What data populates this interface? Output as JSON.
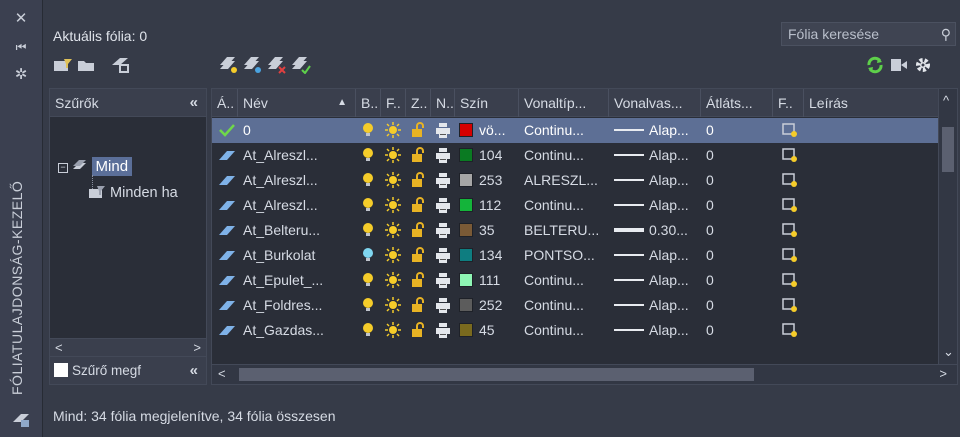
{
  "palette_title": "FÓLIATULAJDONSÁG-KEZELŐ",
  "current_layer_label": "Aktuális fólia: 0",
  "search": {
    "placeholder": "Fólia keresése"
  },
  "filters": {
    "header": "Szűrők",
    "root": "Mind",
    "child": "Minden ha",
    "invert_label": "Szűrő megf"
  },
  "columns": [
    "Á..",
    "Név",
    "B..",
    "F..",
    "Z..",
    "N..",
    "Szín",
    "Vonaltíp...",
    "Vonalvas...",
    "Átláts...",
    "F..",
    "Leírás"
  ],
  "layers": [
    {
      "name": "0",
      "color_label": "vö...",
      "color": "#d60000",
      "linetype": "Continu...",
      "lineweight": "Alap...",
      "transparency": "0",
      "current": true,
      "bulb": "#f5cc2a",
      "lw_thick": false
    },
    {
      "name": "At_Alreszl...",
      "color_label": "104",
      "color": "#0a7a22",
      "linetype": "Continu...",
      "lineweight": "Alap...",
      "transparency": "0",
      "current": false,
      "bulb": "#f5cc2a",
      "lw_thick": false
    },
    {
      "name": "At_Alreszl...",
      "color_label": "253",
      "color": "#a6a6a6",
      "linetype": "ALRESZL...",
      "lineweight": "Alap...",
      "transparency": "0",
      "current": false,
      "bulb": "#f5cc2a",
      "lw_thick": false
    },
    {
      "name": "At_Alreszl...",
      "color_label": "112",
      "color": "#14b43a",
      "linetype": "Continu...",
      "lineweight": "Alap...",
      "transparency": "0",
      "current": false,
      "bulb": "#f5cc2a",
      "lw_thick": false
    },
    {
      "name": "At_Belteru...",
      "color_label": "35",
      "color": "#7a5a36",
      "linetype": "BELTERU...",
      "lineweight": "0.30...",
      "transparency": "0",
      "current": false,
      "bulb": "#f5cc2a",
      "lw_thick": true
    },
    {
      "name": "At_Burkolat",
      "color_label": "134",
      "color": "#0e7d80",
      "linetype": "PONTSO...",
      "lineweight": "Alap...",
      "transparency": "0",
      "current": false,
      "bulb": "#7fd6f0",
      "lw_thick": false
    },
    {
      "name": "At_Epulet_...",
      "color_label": "111",
      "color": "#8ef5b4",
      "linetype": "Continu...",
      "lineweight": "Alap...",
      "transparency": "0",
      "current": false,
      "bulb": "#f5cc2a",
      "lw_thick": false
    },
    {
      "name": "At_Foldres...",
      "color_label": "252",
      "color": "#5c5c5c",
      "linetype": "Continu...",
      "lineweight": "Alap...",
      "transparency": "0",
      "current": false,
      "bulb": "#f5cc2a",
      "lw_thick": false
    },
    {
      "name": "At_Gazdas...",
      "color_label": "45",
      "color": "#7a6a1e",
      "linetype": "Continu...",
      "lineweight": "Alap...",
      "transparency": "0",
      "current": false,
      "bulb": "#f5cc2a",
      "lw_thick": false
    }
  ],
  "status": "Mind: 34 fólia megjelenítve, 34 fólia összesen"
}
